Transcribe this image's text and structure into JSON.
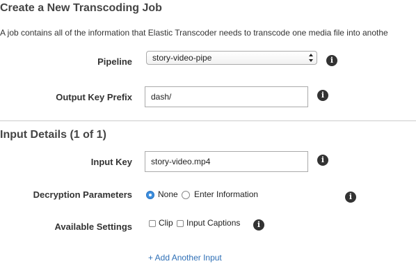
{
  "job_header": {
    "title": "Create a New Transcoding Job",
    "description": "A job contains all of the information that Elastic Transcoder needs to transcode one media file into anothe"
  },
  "pipeline": {
    "label": "Pipeline",
    "selected": "story-video-pipe"
  },
  "output_key_prefix": {
    "label": "Output Key Prefix",
    "value": "dash/"
  },
  "input_details": {
    "title": "Input Details (1 of 1)",
    "input_key": {
      "label": "Input Key",
      "value": "story-video.mp4"
    },
    "decryption": {
      "label": "Decryption Parameters",
      "options": [
        {
          "label": "None",
          "checked": true
        },
        {
          "label": "Enter Information",
          "checked": false
        }
      ]
    },
    "available_settings": {
      "label": "Available Settings",
      "options": [
        {
          "label": "Clip",
          "checked": false
        },
        {
          "label": "Input Captions",
          "checked": false
        }
      ]
    },
    "add_input_label": "+ Add Another Input"
  },
  "icons": {
    "info": "info-icon",
    "select_arrows": "select-arrows-icon"
  },
  "colors": {
    "accent": "#3d8fde",
    "link": "#2e6fb6",
    "divider": "#cccccc"
  }
}
